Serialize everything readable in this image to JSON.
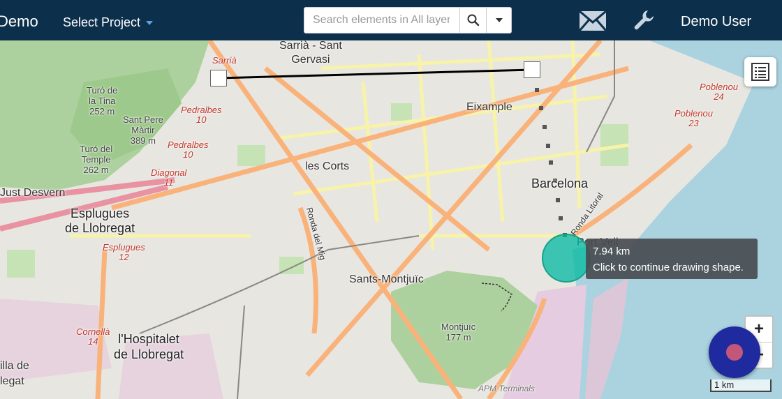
{
  "header": {
    "brand": "Demo",
    "project_label": "Select Project",
    "search_placeholder": "Search elements in All layers",
    "user_name": "Demo User"
  },
  "icons": {
    "search": "search-icon",
    "dropdown": "caret-down-icon",
    "mail": "envelope-icon",
    "settings": "wrench-icon",
    "layers": "layers-list-icon"
  },
  "map": {
    "labels": {
      "sarria_sant_gervasi": "Sarrià - Sant\nGervasi",
      "eixample": "Eixample",
      "les_corts": "les Corts",
      "barcelona": "Barcelona",
      "esplugues": "Esplugues\nde Llobregat",
      "just_desvern": "Just Desvern",
      "sants_montjuic": "Sants-Montjuïc",
      "hospitalet": "l'Hospitalet\nde Llobregat",
      "port_vell": "Port Vell",
      "montjuic": "Montjuïc\n177 m",
      "turo_tina": "Turó de\nla Tina\n252 m",
      "sant_pere": "Sant Pere\nMàrtir\n389 m",
      "turo_temple": "Turó del\nTemple\n262 m",
      "pedralbes_10": "Pedralbes\n10",
      "pedralbes_2": "Pedralbes\n10",
      "diagonal": "Diagonal\n11",
      "esplugues_12": "Esplugues\n12",
      "cornella": "Cornellà\n14",
      "sarria": "Sarrià",
      "poblenou_24": "Poblenou\n24",
      "poblenou_23": "Poblenou\n23",
      "ronda_mig": "Ronda del Mig",
      "ronda_litoral": "Ronda Litoral",
      "apm": "APM Terminals",
      "legat": "legat",
      "illa": "illa de"
    },
    "measure_distance": "7.94 km",
    "measure_hint": "Click to continue drawing shape.",
    "scale_label": "1 km",
    "colors": {
      "water": "#aad3df",
      "park": "#add19e",
      "residential": "#e8e6e1",
      "road_major": "#f9b27a",
      "road_secondary": "#f7f3a8",
      "accent_circle": "#00b8a0",
      "fab": "#1e2a9e"
    }
  }
}
